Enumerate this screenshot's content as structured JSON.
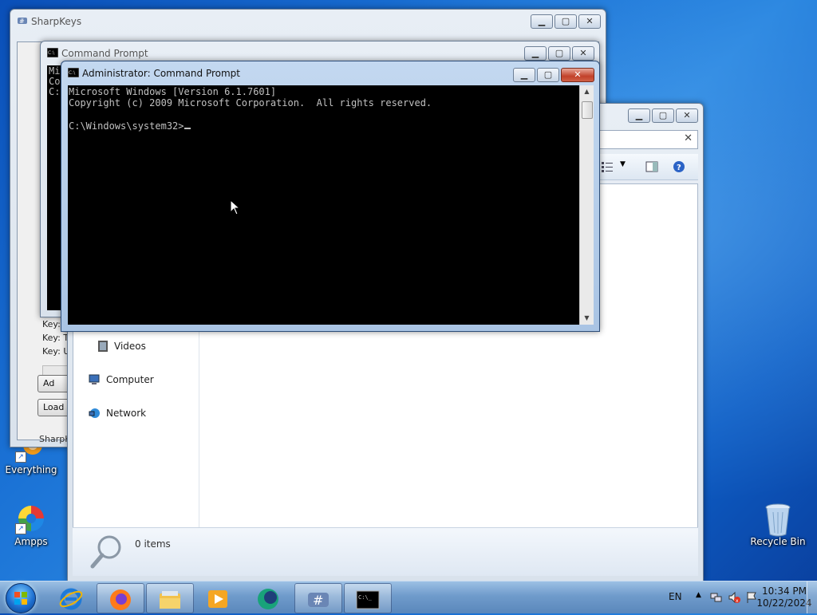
{
  "desktop": {
    "icons": [
      {
        "label": "Everything",
        "icon": "everything-icon"
      },
      {
        "label": "Ampps",
        "icon": "ampps-icon"
      },
      {
        "label": "Recycle Bin",
        "icon": "recycle-bin-icon"
      }
    ]
  },
  "sharpkeys": {
    "title": "SharpKeys",
    "list": [
      "Key:",
      "Key: T",
      "Key: U"
    ],
    "buttons": {
      "add": "Ad",
      "load": "Load"
    },
    "footer": "SharpK"
  },
  "cmd_background": {
    "title": "Command Prompt",
    "peek_lines": [
      "Mi",
      "Co",
      "",
      "C:"
    ]
  },
  "explorer": {
    "nav": {
      "videos": "Videos",
      "computer": "Computer",
      "network": "Network"
    },
    "status": {
      "item_count": "0 items"
    }
  },
  "cmd_active": {
    "title": "Administrator: Command Prompt",
    "lines": [
      "Microsoft Windows [Version 6.1.7601]",
      "Copyright (c) 2009 Microsoft Corporation.  All rights reserved.",
      "",
      "C:\\Windows\\system32>"
    ]
  },
  "taskbar": {
    "apps": [
      "internet-explorer-icon",
      "firefox-icon",
      "file-explorer-icon",
      "media-player-icon",
      "app-icon",
      "sharpkeys-icon",
      "command-prompt-icon"
    ],
    "tray": {
      "language": "EN",
      "time": "10:34 PM",
      "date": "10/22/2024"
    }
  },
  "colors": {
    "console_bg": "#000000",
    "console_text": "#c0c0c0",
    "close_button": "#c2412a"
  }
}
